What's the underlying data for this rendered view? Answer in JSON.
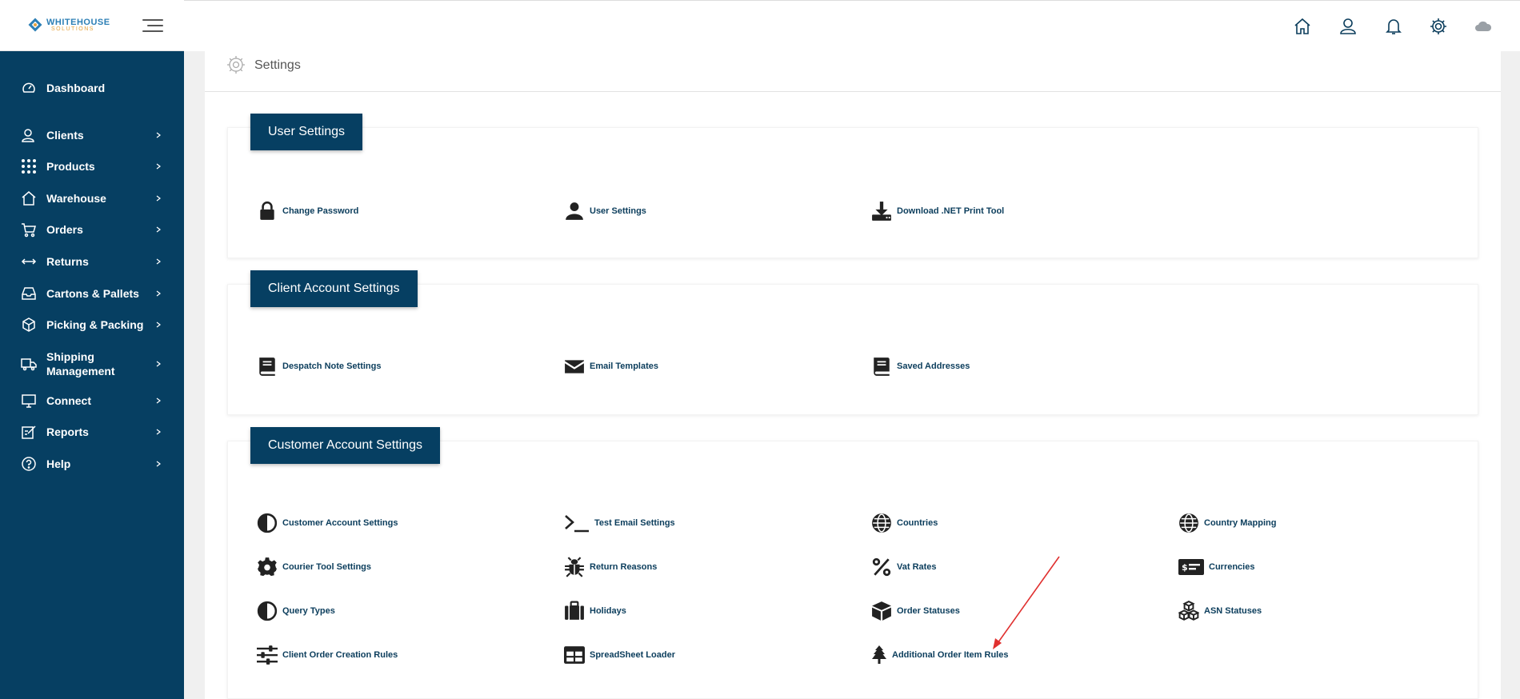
{
  "brand": {
    "name": "WHITEHOUSE",
    "tagline": "SOLUTIONS"
  },
  "colors": {
    "sidebar": "#063f62",
    "accent": "#063f62",
    "annotation_arrow": "#e0302f"
  },
  "sidebar": {
    "items": [
      {
        "label": "Dashboard",
        "icon": "dashboard-gauge-icon",
        "has_submenu": false
      },
      {
        "label": "Clients",
        "icon": "clients-user-icon",
        "has_submenu": true
      },
      {
        "label": "Products",
        "icon": "products-grid-icon",
        "has_submenu": true
      },
      {
        "label": "Warehouse",
        "icon": "warehouse-house-icon",
        "has_submenu": true
      },
      {
        "label": "Orders",
        "icon": "orders-cart-icon",
        "has_submenu": true
      },
      {
        "label": "Returns",
        "icon": "returns-arrows-icon",
        "has_submenu": true
      },
      {
        "label": "Cartons & Pallets",
        "icon": "cartons-tray-icon",
        "has_submenu": true
      },
      {
        "label": "Picking & Packing",
        "icon": "picking-box-icon",
        "has_submenu": true
      },
      {
        "label": "Shipping Management",
        "label_line1": "Shipping",
        "label_line2": "Management",
        "icon": "shipping-truck-icon",
        "has_submenu": true
      },
      {
        "label": "Connect",
        "icon": "connect-monitor-icon",
        "has_submenu": true
      },
      {
        "label": "Reports",
        "icon": "reports-edit-icon",
        "has_submenu": true
      },
      {
        "label": "Help",
        "icon": "help-question-icon",
        "has_submenu": true
      }
    ]
  },
  "topbar": {
    "icons": [
      "home-icon",
      "user-icon",
      "bell-icon",
      "settings-gear-icon",
      "avatar-cloud-icon"
    ]
  },
  "page": {
    "title": "Settings",
    "title_icon": "settings-gear-icon"
  },
  "sections": [
    {
      "title": "User Settings",
      "links": [
        {
          "label": "Change Password",
          "icon": "lock-icon"
        },
        {
          "label": "User Settings",
          "icon": "user-icon"
        },
        {
          "label": "Download .NET Print Tool",
          "icon": "download-tray-icon"
        }
      ]
    },
    {
      "title": "Client Account Settings",
      "links": [
        {
          "label": "Despatch Note Settings",
          "icon": "book-icon"
        },
        {
          "label": "Email Templates",
          "icon": "envelope-icon"
        },
        {
          "label": "Saved Addresses",
          "icon": "book-icon"
        }
      ]
    },
    {
      "title": "Customer Account Settings",
      "links": [
        {
          "label": "Customer Account Settings",
          "icon": "half-circle-icon"
        },
        {
          "label": "Test Email Settings",
          "icon": "terminal-icon"
        },
        {
          "label": "Countries",
          "icon": "globe-icon"
        },
        {
          "label": "Country Mapping",
          "icon": "globe-icon"
        },
        {
          "label": "Courier Tool Settings",
          "icon": "cog-icon"
        },
        {
          "label": "Return Reasons",
          "icon": "bug-icon"
        },
        {
          "label": "Vat Rates",
          "icon": "percent-icon"
        },
        {
          "label": "Currencies",
          "icon": "money-check-icon"
        },
        {
          "label": "Query Types",
          "icon": "half-circle-icon"
        },
        {
          "label": "Holidays",
          "icon": "suitcase-icon"
        },
        {
          "label": "Order Statuses",
          "icon": "cube-icon"
        },
        {
          "label": "ASN Statuses",
          "icon": "cubes-icon"
        },
        {
          "label": "Client Order Creation Rules",
          "icon": "sliders-icon"
        },
        {
          "label": "SpreadSheet Loader",
          "icon": "table-icon"
        },
        {
          "label": "Additional Order Item Rules",
          "icon": "tree-icon"
        }
      ]
    }
  ]
}
